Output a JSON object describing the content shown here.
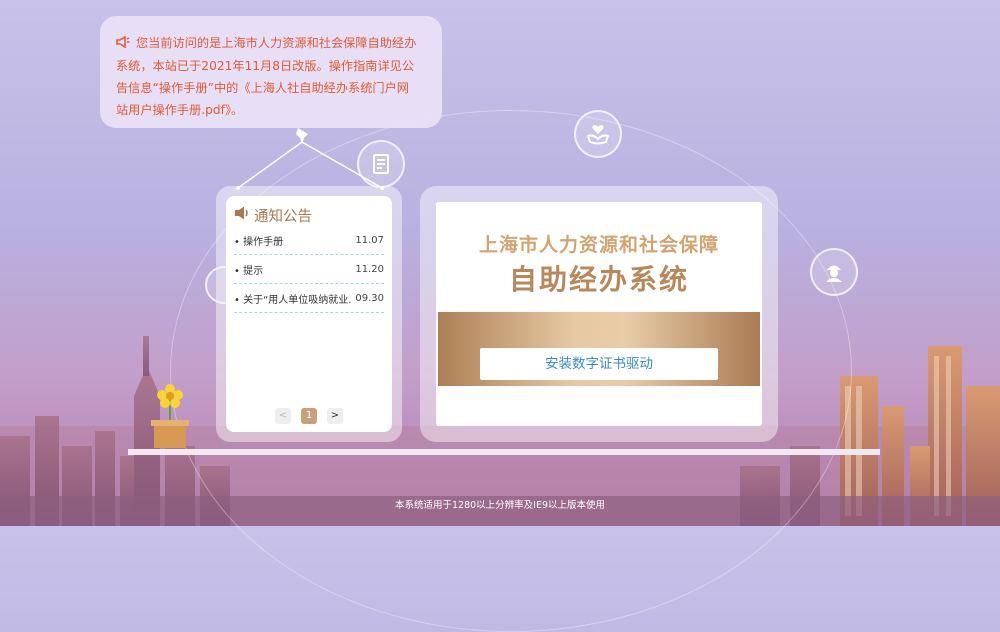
{
  "tooltip": {
    "line1": "您当前访问的是上海市人力资源和社会保障自助经办",
    "line2": "系统，本站已于2021年11月8日改版。操作指南详见公",
    "line3": "告信息“操作手册”中的《上海人社自助经办系统门户网",
    "line4": "站用户操作手册.pdf》。"
  },
  "notice": {
    "title": "通知公告",
    "items": [
      {
        "title": "操作手册",
        "date": "11.07"
      },
      {
        "title": "提示",
        "date": "11.20"
      },
      {
        "title": "关于“用人单位吸纳就业...",
        "date": "09.30"
      }
    ],
    "pager": {
      "prev": "<",
      "current": "1",
      "next": ">"
    }
  },
  "main": {
    "title_line1": "上海市人力资源和社会保障",
    "title_line2": "自助经办系统",
    "install_button": "安装数字证书驱动"
  },
  "footer": "本系统适用于1280以上分辨率及IE9以上版本使用",
  "colors": {
    "accent": "#e45a32",
    "gold": "#c8a07a",
    "link": "#3a8ad4"
  },
  "icons": [
    "speaker-icon",
    "pin-icon",
    "document-icon",
    "care-hands-icon",
    "worker-icon",
    "flower-pot-icon"
  ]
}
